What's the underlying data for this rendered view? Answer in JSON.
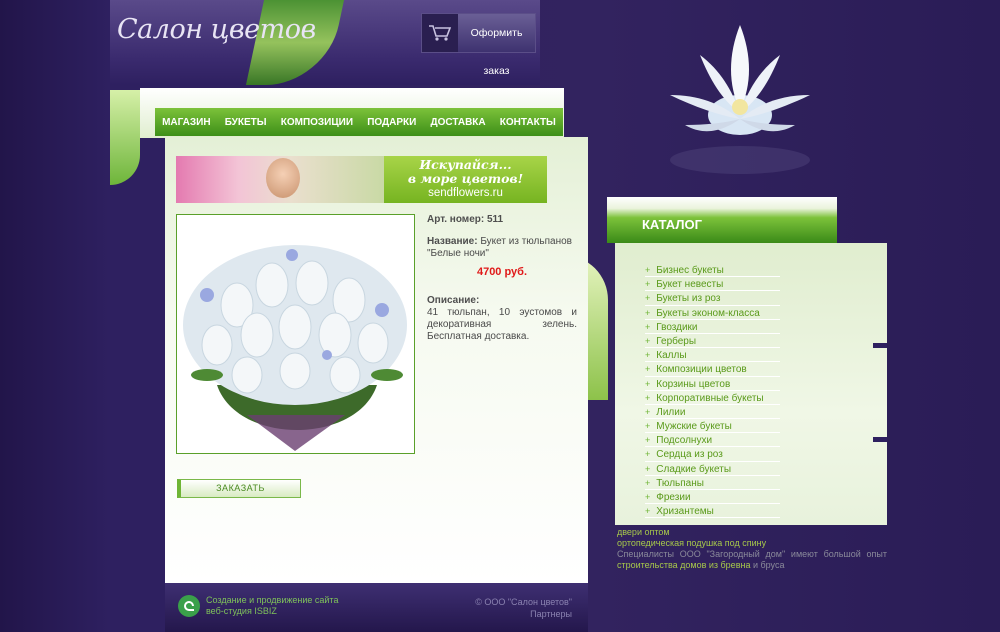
{
  "header": {
    "site_title": "Салон цветов",
    "order_button": "Оформить заказ"
  },
  "nav": {
    "items": [
      "МАГАЗИН",
      "БУКЕТЫ",
      "КОМПОЗИЦИИ",
      "ПОДАРКИ",
      "ДОСТАВКА",
      "КОНТАКТЫ"
    ]
  },
  "banner": {
    "line1": "Искупайся...",
    "line2": "в море цветов!",
    "domain": "sendflowers.ru"
  },
  "product": {
    "art_label": "Арт. номер:",
    "art_value": "511",
    "name_label": "Название:",
    "name_value": "Букет из тюльпанов \"Белые ночи\"",
    "price": "4700 руб.",
    "desc_label": "Описание:",
    "desc_value": "41 тюльпан, 10 эустомов и декоративная зелень. Бесплатная доставка.",
    "order_button": "ЗАКАЗАТЬ"
  },
  "catalog": {
    "title": "КАТАЛОГ",
    "items": [
      "Бизнес букеты",
      "Букет невесты",
      "Букеты из роз",
      "Букеты эконом-класса",
      "Гвоздики",
      "Герберы",
      "Каллы",
      "Композиции цветов",
      "Корзины цветов",
      "Корпоративные букеты",
      "Лилии",
      "Мужские букеты",
      "Подсолнухи",
      "Сердца из роз",
      "Сладкие букеты",
      "Тюльпаны",
      "Фрезии",
      "Хризантемы"
    ]
  },
  "side": {
    "link1": "двери оптом",
    "link2": "ортопедическая подушка под спину",
    "text_before": "Специалисты ООО \"Загородный дом\" имеют большой опыт ",
    "link3": "строительства домов из бревна",
    "text_after": " и бруса"
  },
  "footer": {
    "left_line1": "Создание и продвижение сайта",
    "left_line2": "веб-студия ISBIZ",
    "copyright": "© ООО \"Салон цветов\"",
    "partners": "Партнеры"
  }
}
